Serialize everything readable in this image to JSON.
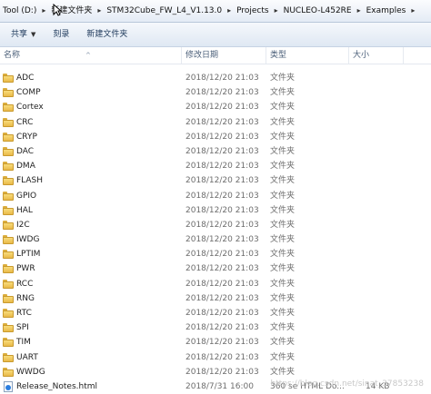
{
  "breadcrumb": [
    "Tool (D:)",
    "新建文件夹",
    "STM32Cube_FW_L4_V1.13.0",
    "Projects",
    "NUCLEO-L452RE",
    "Examples"
  ],
  "toolbar": {
    "share_label": "共享",
    "burn_label": "刻录",
    "new_folder_label": "新建文件夹"
  },
  "columns": {
    "name": "名称",
    "modified": "修改日期",
    "type": "类型",
    "size": "大小"
  },
  "rows": [
    {
      "name": "ADC",
      "date": "2018/12/20 21:03",
      "type": "文件夹",
      "size": "",
      "icon": "folder-icon"
    },
    {
      "name": "COMP",
      "date": "2018/12/20 21:03",
      "type": "文件夹",
      "size": "",
      "icon": "folder-icon"
    },
    {
      "name": "Cortex",
      "date": "2018/12/20 21:03",
      "type": "文件夹",
      "size": "",
      "icon": "folder-icon"
    },
    {
      "name": "CRC",
      "date": "2018/12/20 21:03",
      "type": "文件夹",
      "size": "",
      "icon": "folder-icon"
    },
    {
      "name": "CRYP",
      "date": "2018/12/20 21:03",
      "type": "文件夹",
      "size": "",
      "icon": "folder-icon"
    },
    {
      "name": "DAC",
      "date": "2018/12/20 21:03",
      "type": "文件夹",
      "size": "",
      "icon": "folder-icon"
    },
    {
      "name": "DMA",
      "date": "2018/12/20 21:03",
      "type": "文件夹",
      "size": "",
      "icon": "folder-icon"
    },
    {
      "name": "FLASH",
      "date": "2018/12/20 21:03",
      "type": "文件夹",
      "size": "",
      "icon": "folder-icon"
    },
    {
      "name": "GPIO",
      "date": "2018/12/20 21:03",
      "type": "文件夹",
      "size": "",
      "icon": "folder-icon"
    },
    {
      "name": "HAL",
      "date": "2018/12/20 21:03",
      "type": "文件夹",
      "size": "",
      "icon": "folder-icon"
    },
    {
      "name": "I2C",
      "date": "2018/12/20 21:03",
      "type": "文件夹",
      "size": "",
      "icon": "folder-icon"
    },
    {
      "name": "IWDG",
      "date": "2018/12/20 21:03",
      "type": "文件夹",
      "size": "",
      "icon": "folder-icon"
    },
    {
      "name": "LPTIM",
      "date": "2018/12/20 21:03",
      "type": "文件夹",
      "size": "",
      "icon": "folder-icon"
    },
    {
      "name": "PWR",
      "date": "2018/12/20 21:03",
      "type": "文件夹",
      "size": "",
      "icon": "folder-icon"
    },
    {
      "name": "RCC",
      "date": "2018/12/20 21:03",
      "type": "文件夹",
      "size": "",
      "icon": "folder-icon"
    },
    {
      "name": "RNG",
      "date": "2018/12/20 21:03",
      "type": "文件夹",
      "size": "",
      "icon": "folder-icon"
    },
    {
      "name": "RTC",
      "date": "2018/12/20 21:03",
      "type": "文件夹",
      "size": "",
      "icon": "folder-icon"
    },
    {
      "name": "SPI",
      "date": "2018/12/20 21:03",
      "type": "文件夹",
      "size": "",
      "icon": "folder-icon"
    },
    {
      "name": "TIM",
      "date": "2018/12/20 21:03",
      "type": "文件夹",
      "size": "",
      "icon": "folder-icon"
    },
    {
      "name": "UART",
      "date": "2018/12/20 21:03",
      "type": "文件夹",
      "size": "",
      "icon": "folder-icon"
    },
    {
      "name": "WWDG",
      "date": "2018/12/20 21:03",
      "type": "文件夹",
      "size": "",
      "icon": "folder-icon"
    },
    {
      "name": "Release_Notes.html",
      "date": "2018/7/31 16:00",
      "type": "360 se HTML Do...",
      "size": "14 KB",
      "icon": "html-file-icon"
    }
  ],
  "watermark": "https://blog.csdn.net/sinat_37853238"
}
